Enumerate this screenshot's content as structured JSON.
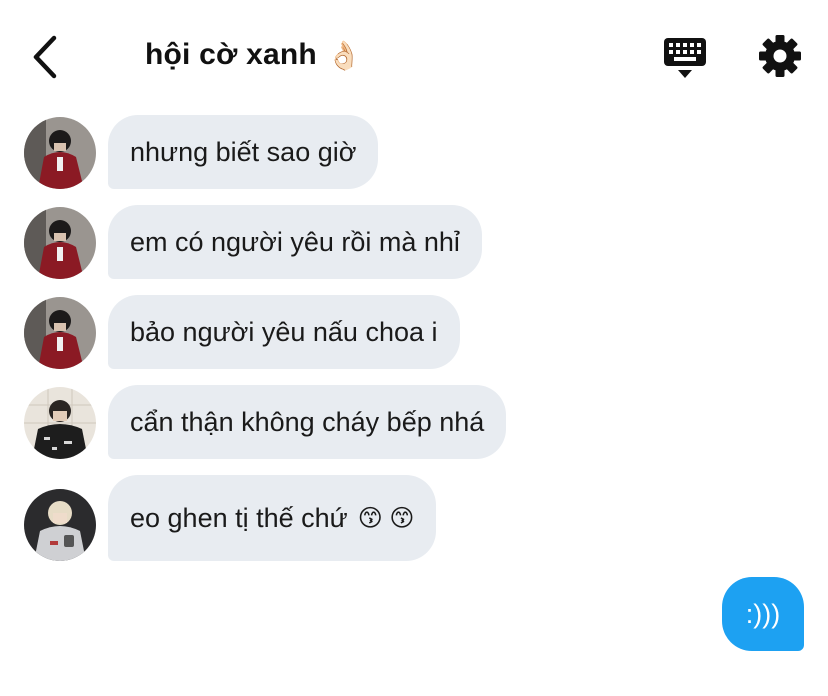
{
  "header": {
    "title": "hội cờ xanh",
    "title_emoji": "👌🏻",
    "icons": {
      "back": "chevron-left-icon",
      "keyboard": "keyboard-icon",
      "settings": "gear-icon"
    }
  },
  "messages": [
    {
      "text": "nhưng biết sao giờ"
    },
    {
      "text": "em có người yêu rồi mà nhỉ"
    },
    {
      "text": "bảo người yêu nấu choa i"
    },
    {
      "text": "cẩn thận không cháy bếp nhá"
    },
    {
      "text": "eo ghen tị thế chứ",
      "emojis": "😙 😙"
    }
  ],
  "outgoing": {
    "text": ":)))"
  },
  "colors": {
    "incoming_bubble": "#e8ecf1",
    "outgoing_bubble": "#1da1f2",
    "icon": "#111111"
  }
}
